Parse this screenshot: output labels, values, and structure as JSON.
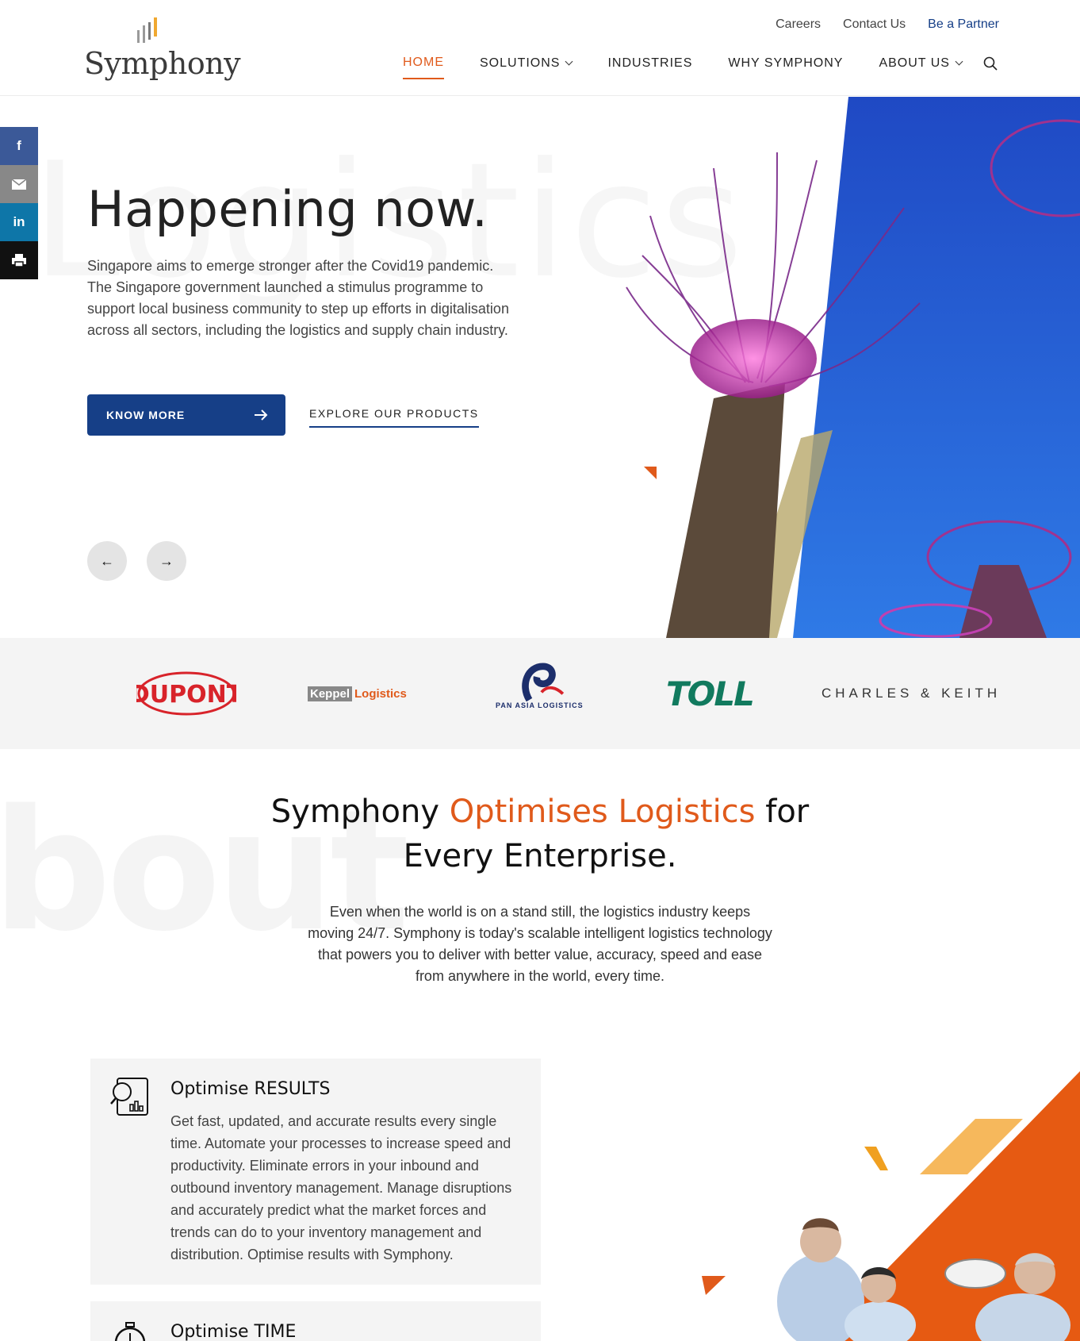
{
  "header": {
    "logo_text": "Symphony",
    "util_links": {
      "careers": "Careers",
      "contact": "Contact Us",
      "partner": "Be a Partner"
    },
    "nav": {
      "home": "HOME",
      "solutions": "SOLUTIONS",
      "industries": "INDUSTRIES",
      "why": "WHY SYMPHONY",
      "about": "ABOUT US"
    }
  },
  "share": {
    "facebook": "f",
    "linkedin": "in"
  },
  "hero": {
    "bg_word": "Logistics",
    "title": "Happening now.",
    "text": "Singapore aims to emerge stronger after the Covid19 pandemic. The Singapore government launched a stimulus programme to support local business community to step up efforts in digitalisation across all sectors, including the logistics and supply chain industry.",
    "primary_button": "KNOW MORE",
    "secondary_link": "EXPLORE OUR PRODUCTS",
    "prev_arrow": "←",
    "next_arrow": "→"
  },
  "clients": {
    "dupont": "DUPONT",
    "keppel_a": "Keppel",
    "keppel_b": "Logistics",
    "panasia": "PAN ASIA LOGISTICS",
    "toll": "TOLL",
    "charles": "CHARLES & KEITH"
  },
  "about": {
    "bg_word": "bout",
    "title_a": "Symphony ",
    "title_hl": "Optimises Logistics",
    "title_b": " for",
    "title_c": "Every Enterprise.",
    "text": "Even when the world is on a stand still, the logistics industry keeps moving 24/7. Symphony is today's scalable intelligent logistics technology that powers you to deliver with better value, accuracy, speed and ease from anywhere in the world, every time."
  },
  "features": [
    {
      "title": "Optimise RESULTS",
      "text": "Get fast, updated, and accurate results every single time. Automate your processes to increase speed and productivity. Eliminate errors in your inbound and outbound inventory management. Manage disruptions and accurately predict what the market forces and trends can do to your inventory management and distribution. Optimise results with Symphony."
    },
    {
      "title": "Optimise TIME"
    }
  ],
  "colors": {
    "brand_blue": "#163f87",
    "accent_orange": "#e05a1b"
  }
}
